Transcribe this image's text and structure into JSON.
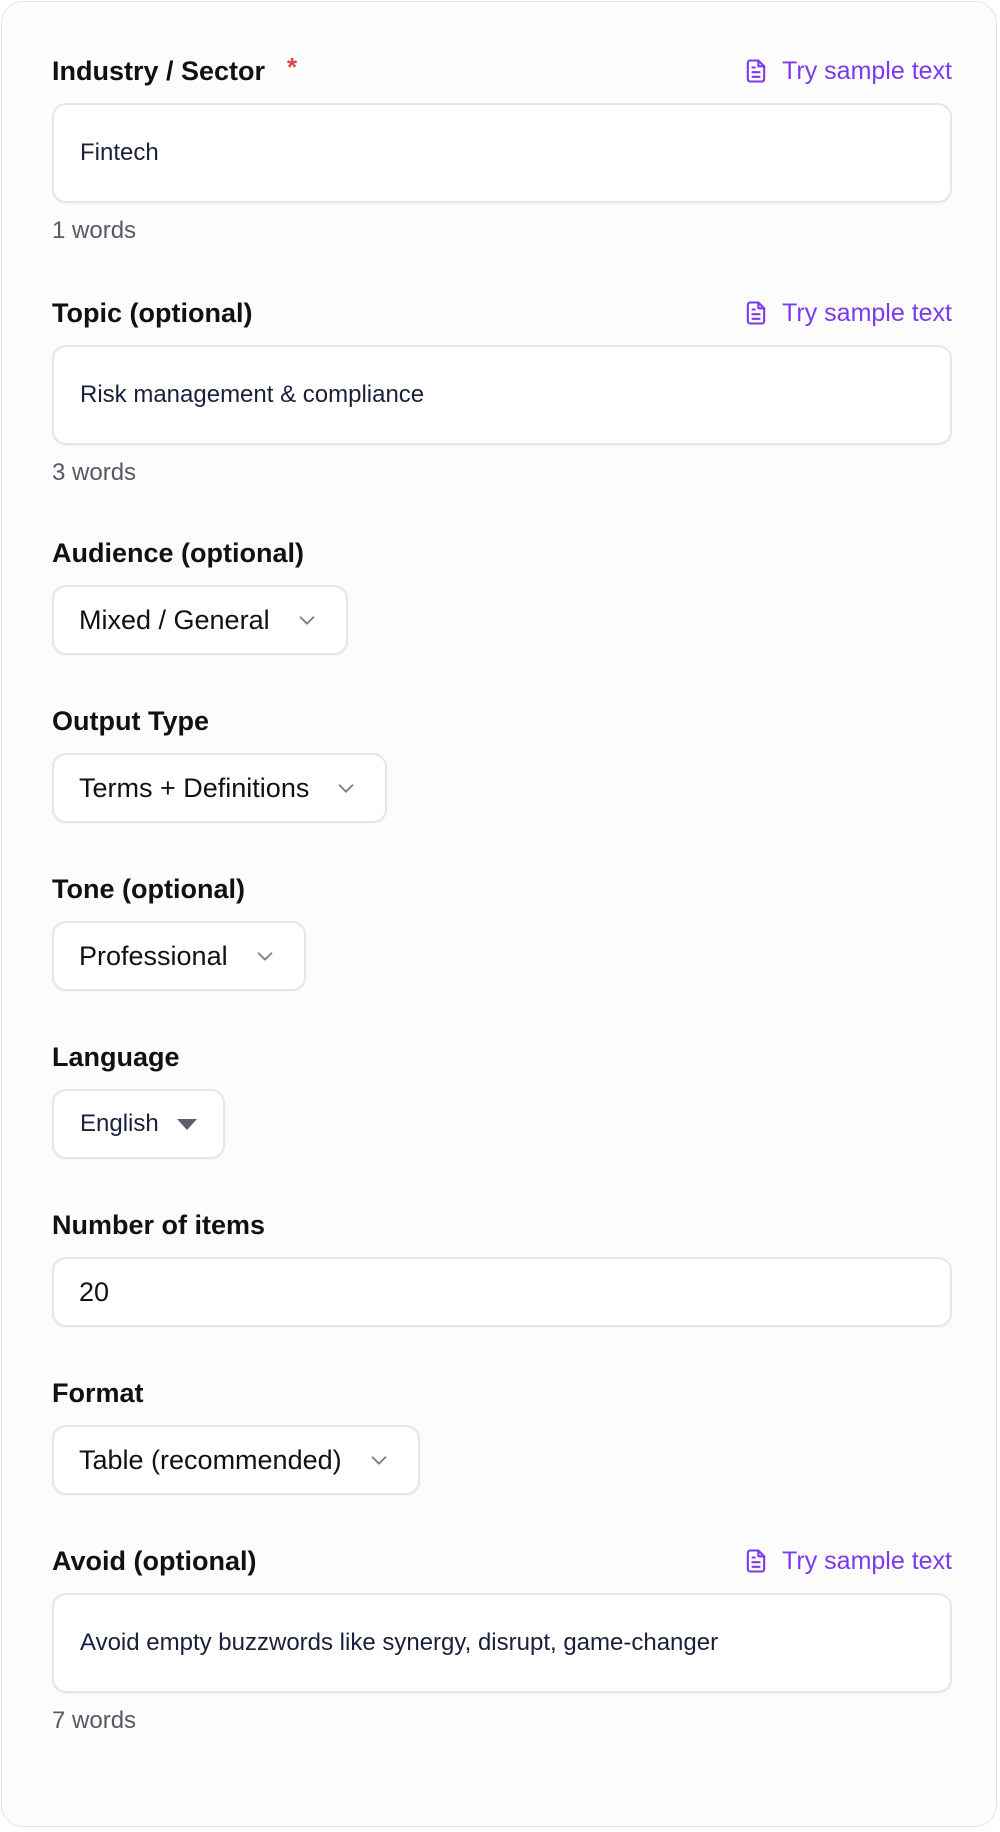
{
  "industry": {
    "label": "Industry / Sector",
    "required_mark": "*",
    "sample_link": "Try sample text",
    "value": "Fintech",
    "word_count": "1 words"
  },
  "topic": {
    "label": "Topic (optional)",
    "sample_link": "Try sample text",
    "value": "Risk management & compliance",
    "word_count": "3 words"
  },
  "audience": {
    "label": "Audience (optional)",
    "selected": "Mixed / General"
  },
  "output_type": {
    "label": "Output Type",
    "selected": "Terms + Definitions"
  },
  "tone": {
    "label": "Tone (optional)",
    "selected": "Professional"
  },
  "language": {
    "label": "Language",
    "selected": "English"
  },
  "number_of_items": {
    "label": "Number of items",
    "value": "20"
  },
  "format": {
    "label": "Format",
    "selected": "Table (recommended)"
  },
  "avoid": {
    "label": "Avoid (optional)",
    "sample_link": "Try sample text",
    "value": "Avoid empty buzzwords like synergy, disrupt, game-changer",
    "word_count": "7 words"
  },
  "colors": {
    "accent": "#7c3aed",
    "required": "#e0454b",
    "border": "#e4e6ea"
  },
  "icons": {
    "sample": "document-icon",
    "dropdown": "chevron-down-icon",
    "language_dropdown": "caret-down-icon"
  }
}
